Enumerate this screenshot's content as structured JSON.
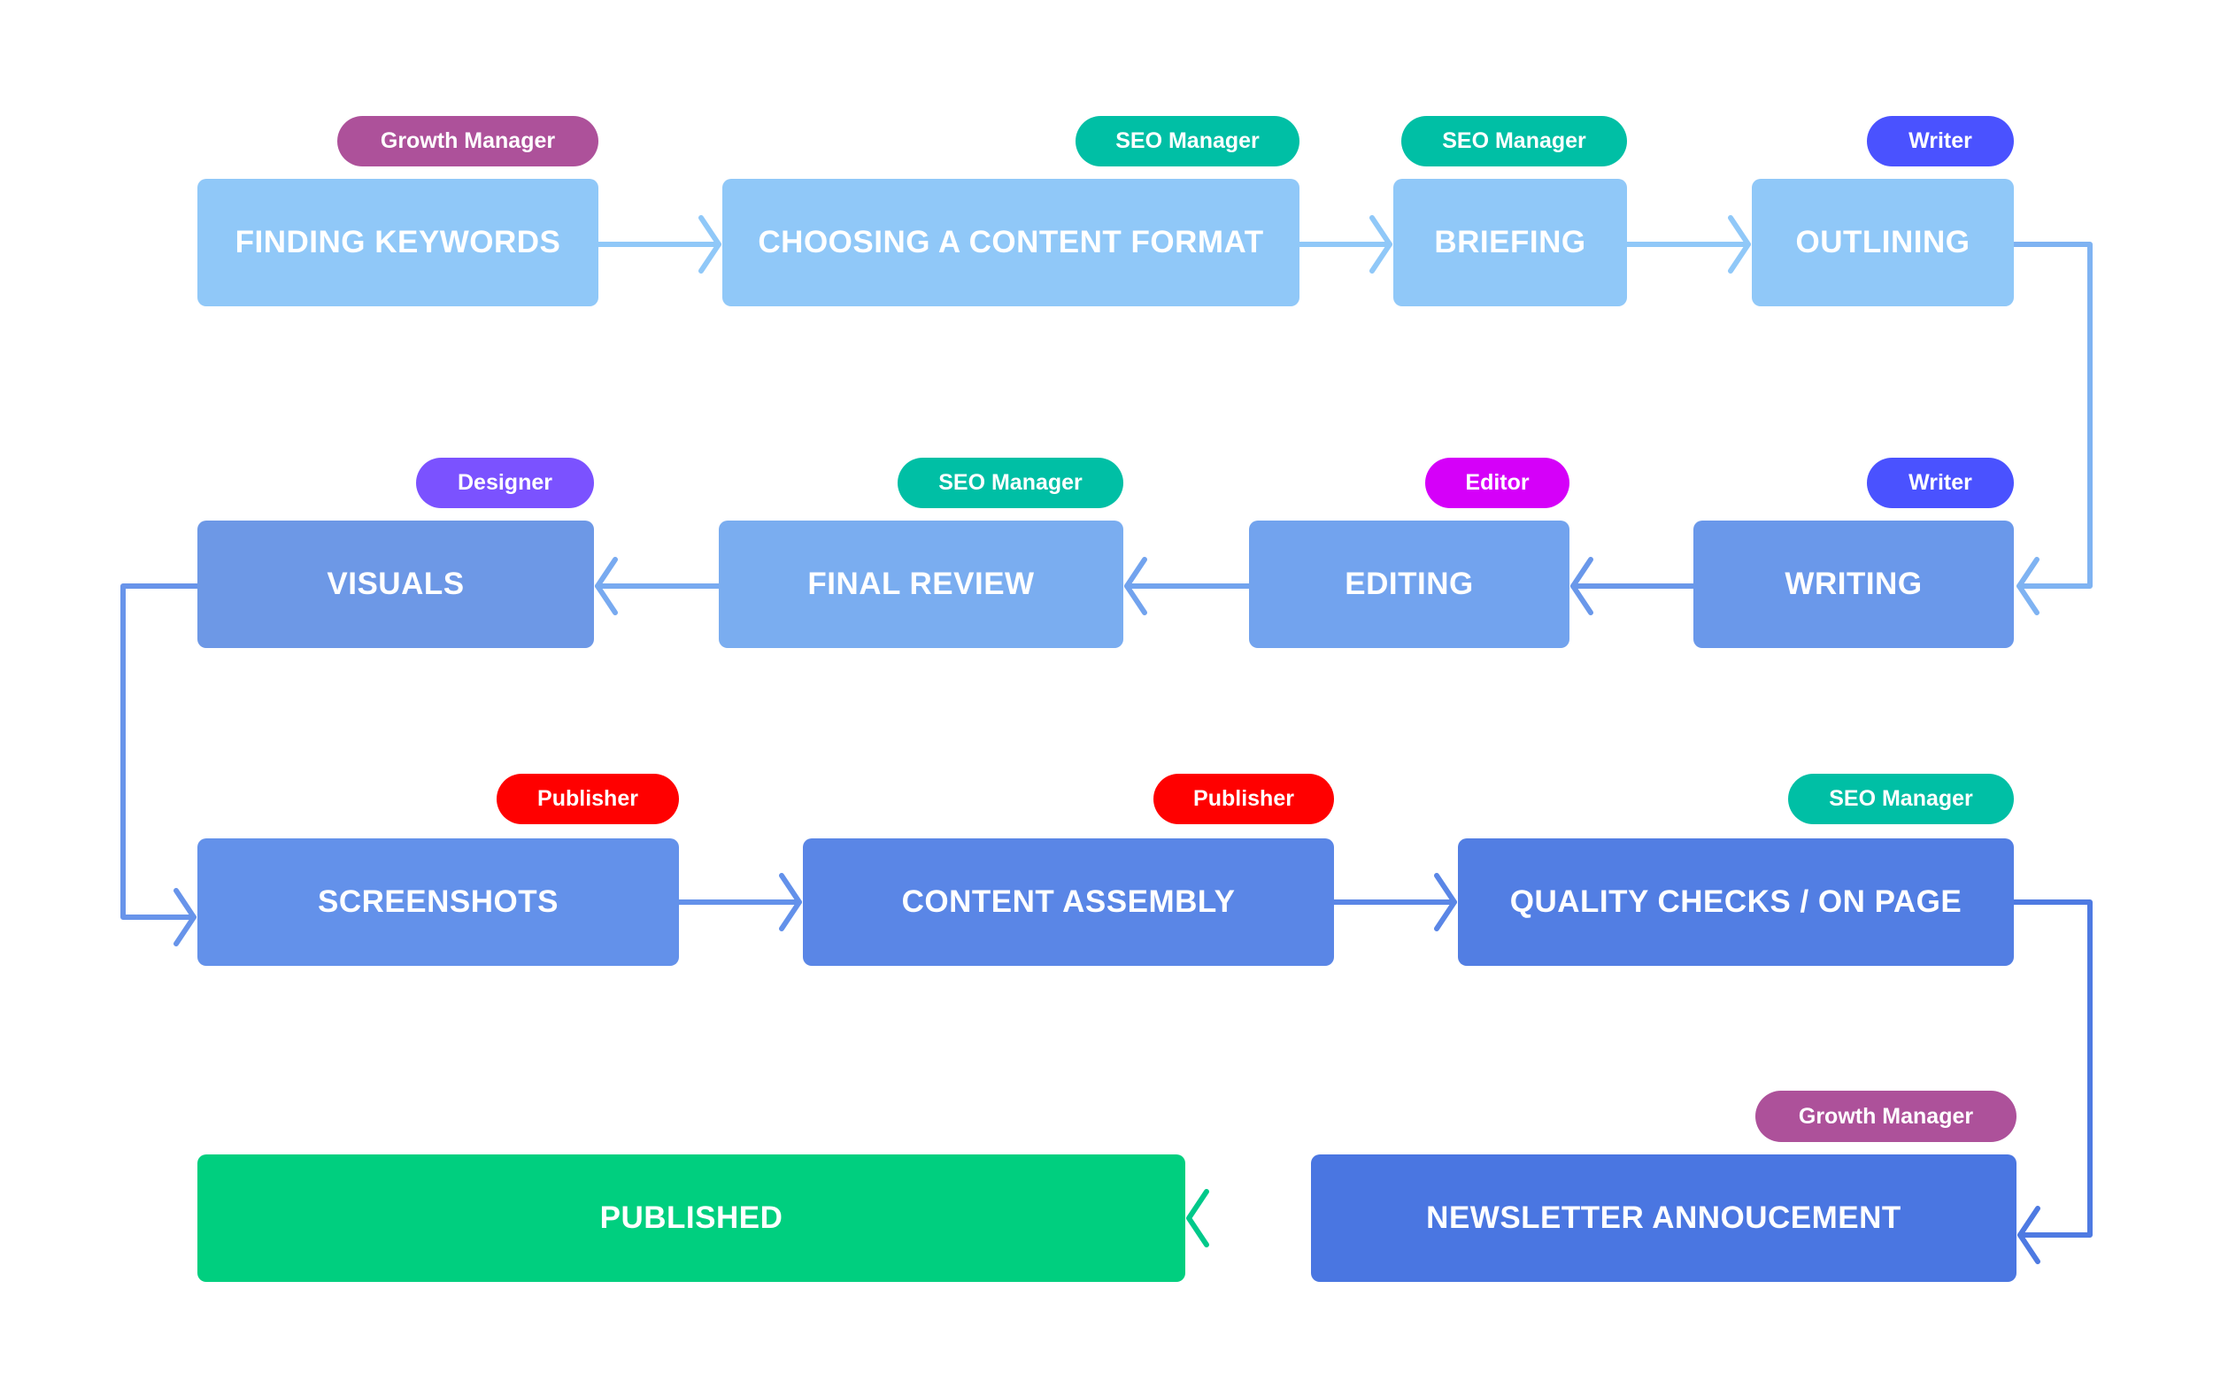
{
  "diagram": {
    "title": "",
    "colors": {
      "growth_manager": "#AD519A",
      "seo_manager": "#00BFA5",
      "writer": "#4A52FF",
      "designer": "#7B52FF",
      "editor": "#D500F9",
      "publisher": "#FF0000",
      "published": "#00CF7F"
    },
    "steps": [
      {
        "label": "FINDING KEYWORDS",
        "role": "Growth Manager"
      },
      {
        "label": "CHOOSING A CONTENT FORMAT",
        "role": "SEO Manager"
      },
      {
        "label": "BRIEFING",
        "role": "SEO Manager"
      },
      {
        "label": "OUTLINING",
        "role": "Writer"
      },
      {
        "label": "WRITING",
        "role": "Writer"
      },
      {
        "label": "EDITING",
        "role": "Editor"
      },
      {
        "label": "FINAL REVIEW",
        "role": "SEO Manager"
      },
      {
        "label": "VISUALS",
        "role": "Designer"
      },
      {
        "label": "SCREENSHOTS",
        "role": "Publisher"
      },
      {
        "label": "CONTENT ASSEMBLY",
        "role": "Publisher"
      },
      {
        "label": "QUALITY CHECKS / ON PAGE",
        "role": "SEO Manager"
      },
      {
        "label": "NEWSLETTER ANNOUCEMENT",
        "role": "Growth Manager"
      },
      {
        "label": "PUBLISHED",
        "role": ""
      }
    ],
    "flow": [
      [
        "FINDING KEYWORDS",
        "CHOOSING A CONTENT FORMAT"
      ],
      [
        "CHOOSING A CONTENT FORMAT",
        "BRIEFING"
      ],
      [
        "BRIEFING",
        "OUTLINING"
      ],
      [
        "OUTLINING",
        "WRITING"
      ],
      [
        "WRITING",
        "EDITING"
      ],
      [
        "EDITING",
        "FINAL REVIEW"
      ],
      [
        "FINAL REVIEW",
        "VISUALS"
      ],
      [
        "VISUALS",
        "SCREENSHOTS"
      ],
      [
        "SCREENSHOTS",
        "CONTENT ASSEMBLY"
      ],
      [
        "CONTENT ASSEMBLY",
        "QUALITY CHECKS / ON PAGE"
      ],
      [
        "QUALITY CHECKS / ON PAGE",
        "NEWSLETTER ANNOUCEMENT"
      ],
      [
        "NEWSLETTER ANNOUCEMENT",
        "PUBLISHED"
      ]
    ]
  }
}
